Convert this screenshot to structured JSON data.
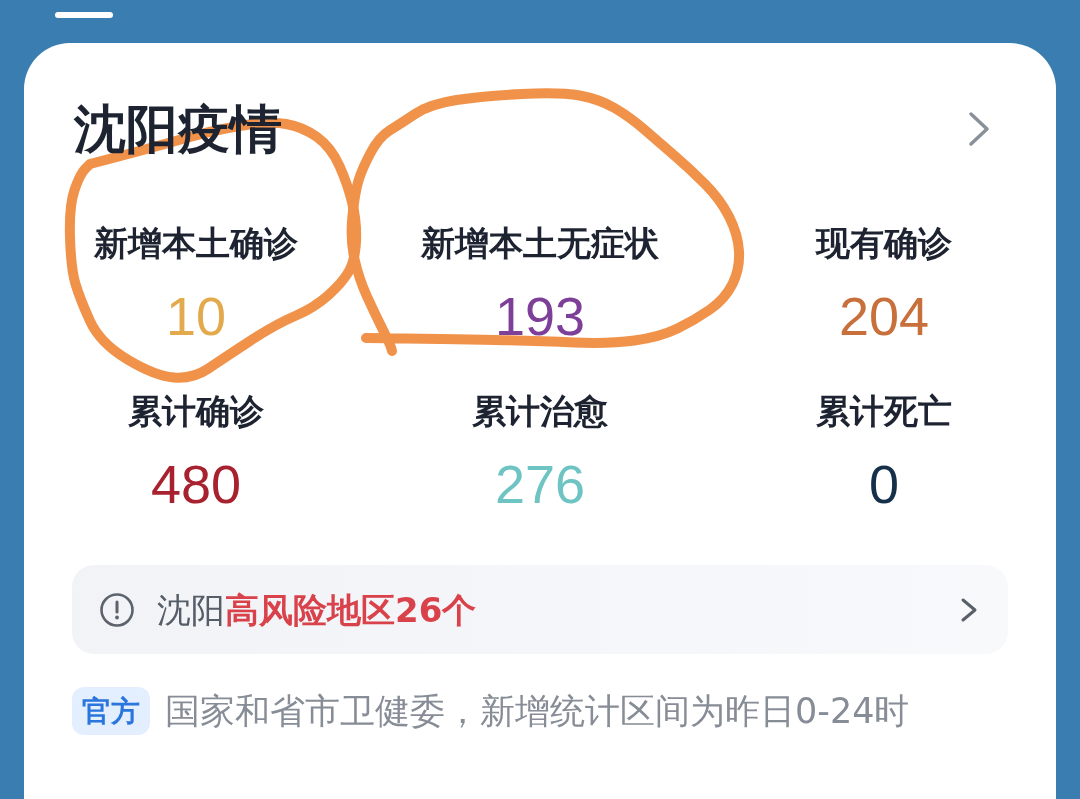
{
  "card": {
    "title": "沈阳疫情",
    "stats": [
      {
        "label": "新增本土确诊",
        "value": "10",
        "color": "#e2aa4c",
        "circled": true
      },
      {
        "label": "新增本土无症状",
        "value": "193",
        "color": "#7d3f98",
        "circled": true
      },
      {
        "label": "现有确诊",
        "value": "204",
        "color": "#c8703c",
        "circled": false
      },
      {
        "label": "累计确诊",
        "value": "480",
        "color": "#a8212f",
        "circled": false
      },
      {
        "label": "累计治愈",
        "value": "276",
        "color": "#6ec3c3",
        "circled": false
      },
      {
        "label": "累计死亡",
        "value": "0",
        "color": "#16304a",
        "circled": false
      }
    ],
    "risk_banner": {
      "text": "沈阳**高风险地区26个**"
    },
    "source": {
      "tag": "官方",
      "text": "国家和省市卫健委，新增统计区间为昨日0-24时"
    }
  }
}
